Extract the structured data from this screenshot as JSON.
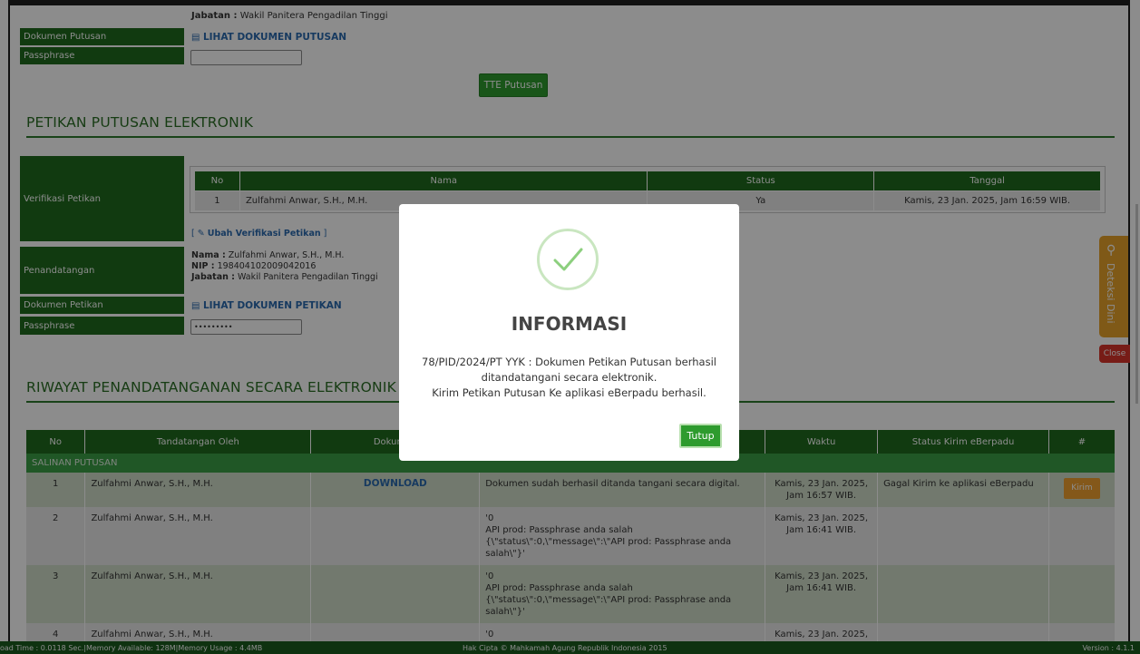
{
  "top": {
    "jabatan_label": "Jabatan :",
    "jabatan_value": " Wakil Panitera Pengadilan Tinggi",
    "dokumen_putusan_label": "Dokumen Putusan",
    "dokumen_putusan_link": "LIHAT DOKUMEN PUTUSAN",
    "passphrase_label": "Passphrase",
    "passphrase_value": "",
    "tte_button": "TTE Putusan"
  },
  "petikan": {
    "title": "PETIKAN PUTUSAN ELEKTRONIK",
    "verifikasi_label": "Verifikasi Petikan",
    "table_headers": [
      "No",
      "Nama",
      "Status",
      "Tanggal"
    ],
    "table_rows": [
      {
        "no": "1",
        "nama": "Zulfahmi Anwar, S.H., M.H.",
        "status": "Ya",
        "tanggal": "Kamis, 23 Jan. 2025, Jam 16:59 WIB."
      }
    ],
    "ubah_link": "Ubah Verifikasi Petikan",
    "penandatangan_label": "Penandatangan",
    "nama_label": "Nama :",
    "nama_value": " Zulfahmi Anwar, S.H., M.H.",
    "nip_label": "NIP :",
    "nip_value": " 198404102009042016",
    "jabatan_label": "Jabatan :",
    "jabatan_value": " Wakil Panitera Pengadilan Tinggi",
    "dokumen_label": "Dokumen Petikan",
    "dokumen_link": "LIHAT DOKUMEN PETIKAN",
    "passphrase_label": "Passphrase",
    "passphrase_value": "•••••••••"
  },
  "riwayat": {
    "title": "RIWAYAT PENANDATANGANAN SECARA ELEKTRONIK",
    "headers": [
      "No",
      "Tandatangan Oleh",
      "Dokumen",
      "",
      "Waktu",
      "Status Kirim eBerpadu",
      "#"
    ],
    "group_label": "SALINAN PUTUSAN",
    "rows": [
      {
        "no": "1",
        "oleh": "Zulfahmi Anwar, S.H., M.H.",
        "dokumen": "DOWNLOAD",
        "keterangan": "Dokumen sudah berhasil ditanda tangani secara digital.",
        "waktu": "Kamis, 23 Jan. 2025, Jam 16:57 WIB.",
        "status": "Gagal Kirim ke aplikasi eBerpadu",
        "aksi": "Kirim"
      },
      {
        "no": "2",
        "oleh": "Zulfahmi Anwar, S.H., M.H.",
        "dokumen": "",
        "keterangan": "'0\nAPI prod: Passphrase anda salah\n{\\\"status\\\":0,\\\"message\\\":\\\"API prod: Passphrase anda salah\\\"}'",
        "waktu": "Kamis, 23 Jan. 2025, Jam 16:41 WIB.",
        "status": "",
        "aksi": ""
      },
      {
        "no": "3",
        "oleh": "Zulfahmi Anwar, S.H., M.H.",
        "dokumen": "",
        "keterangan": "'0\nAPI prod: Passphrase anda salah\n{\\\"status\\\":0,\\\"message\\\":\\\"API prod: Passphrase anda salah\\\"}'",
        "waktu": "Kamis, 23 Jan. 2025, Jam 16:41 WIB.",
        "status": "",
        "aksi": ""
      },
      {
        "no": "4",
        "oleh": "Zulfahmi Anwar, S.H., M.H.",
        "dokumen": "",
        "keterangan": "'0",
        "waktu": "Kamis, 23 Jan. 2025,",
        "status": "",
        "aksi": ""
      }
    ]
  },
  "side_widget": {
    "label": "Deteksi Dini",
    "close": "Close"
  },
  "modal": {
    "title": "INFORMASI",
    "line1": "78/PID/2024/PT YYK : Dokumen Petikan Putusan berhasil",
    "line2": "ditandatangani secara elektronik.",
    "line3": "Kirim Petikan Putusan Ke aplikasi eBerpadu berhasil.",
    "button": "Tutup"
  },
  "footer": {
    "left": "oad Time : 0.0118 Sec.|Memory Available: 128M|Memory Usage : 4.4MB",
    "center": "Hak Cipta © Mahkamah Agung Republik Indonesia 2015",
    "right": "Version : 4.1.1"
  },
  "colors": {
    "primary_green": "#1f6b1e",
    "button_green": "#2e9b2e",
    "link_blue": "#2a6ab0",
    "kirim_orange": "#f0a030",
    "close_red": "#d9342b",
    "widget_orange": "#e8a32a"
  }
}
